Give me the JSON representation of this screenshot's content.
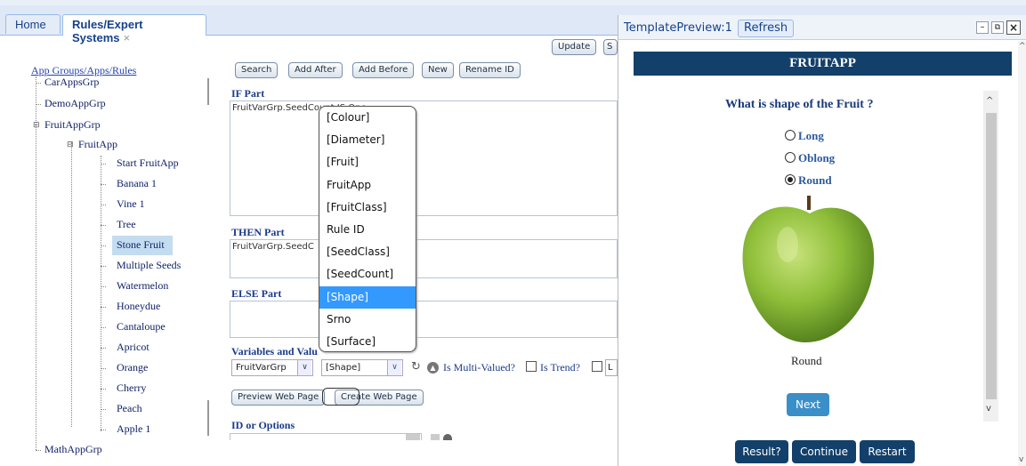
{
  "tabs": {
    "home": "Home",
    "rules": "Rules/Expert Systems",
    "close": "×"
  },
  "top_buttons": {
    "update": "Update",
    "second": "S"
  },
  "tree": {
    "root": "App Groups/Apps/Rules",
    "groups": [
      "CarAppsGrp",
      "DemoAppGrp",
      "FruitAppGrp"
    ],
    "app": "FruitApp",
    "rules": [
      "Start FruitApp",
      "Banana 1",
      "Vine 1",
      "Tree",
      "Stone Fruit",
      "Multiple Seeds",
      "Watermelon",
      "Honeydue",
      "Cantaloupe",
      "Apricot",
      "Orange",
      "Cherry",
      "Peach",
      "Apple 1"
    ],
    "selected_rule": "Stone Fruit",
    "last_group": "MathAppGrp"
  },
  "toolbar": {
    "search": "Search",
    "add_after": "Add After",
    "add_before": "Add Before",
    "new": "New",
    "rename": "Rename ID"
  },
  "editor": {
    "if_label": "IF Part",
    "if_text": "FruitVarGrp.SeedCount IS One",
    "then_label": "THEN Part",
    "then_text": "FruitVarGrp.SeedC",
    "else_label": "ELSE Part",
    "vars_label": "Variables and Valu",
    "var_group": "FruitVarGrp",
    "var_value": "[Shape]",
    "multi_valued": "Is Multi-Valued?",
    "is_trend": "Is Trend?",
    "trailing": "L",
    "preview_btn": "Preview Web Page",
    "create_btn": "Create Web Page",
    "id_label": "ID or Options"
  },
  "listbox": {
    "items": [
      "[Colour]",
      "[Diameter]",
      "[Fruit]",
      "FruitApp",
      "[FruitClass]",
      "Rule ID",
      "[SeedClass]",
      "[SeedCount]",
      "[Shape]",
      "Srno",
      "[Surface]"
    ],
    "selected": "[Shape]"
  },
  "preview": {
    "title": "TemplatePreview:1",
    "refresh": "Refresh",
    "app_title": "FRUITAPP",
    "question": "What is shape of the Fruit ?",
    "options": [
      "Long",
      "Oblong",
      "Round"
    ],
    "selected_option": "Round",
    "image_caption": "Round",
    "next": "Next",
    "result": "Result?",
    "continue": "Continue",
    "restart": "Restart"
  },
  "colors": {
    "accent": "#12406a",
    "selected": "#3399ff",
    "next_button": "#3a8fc9"
  }
}
